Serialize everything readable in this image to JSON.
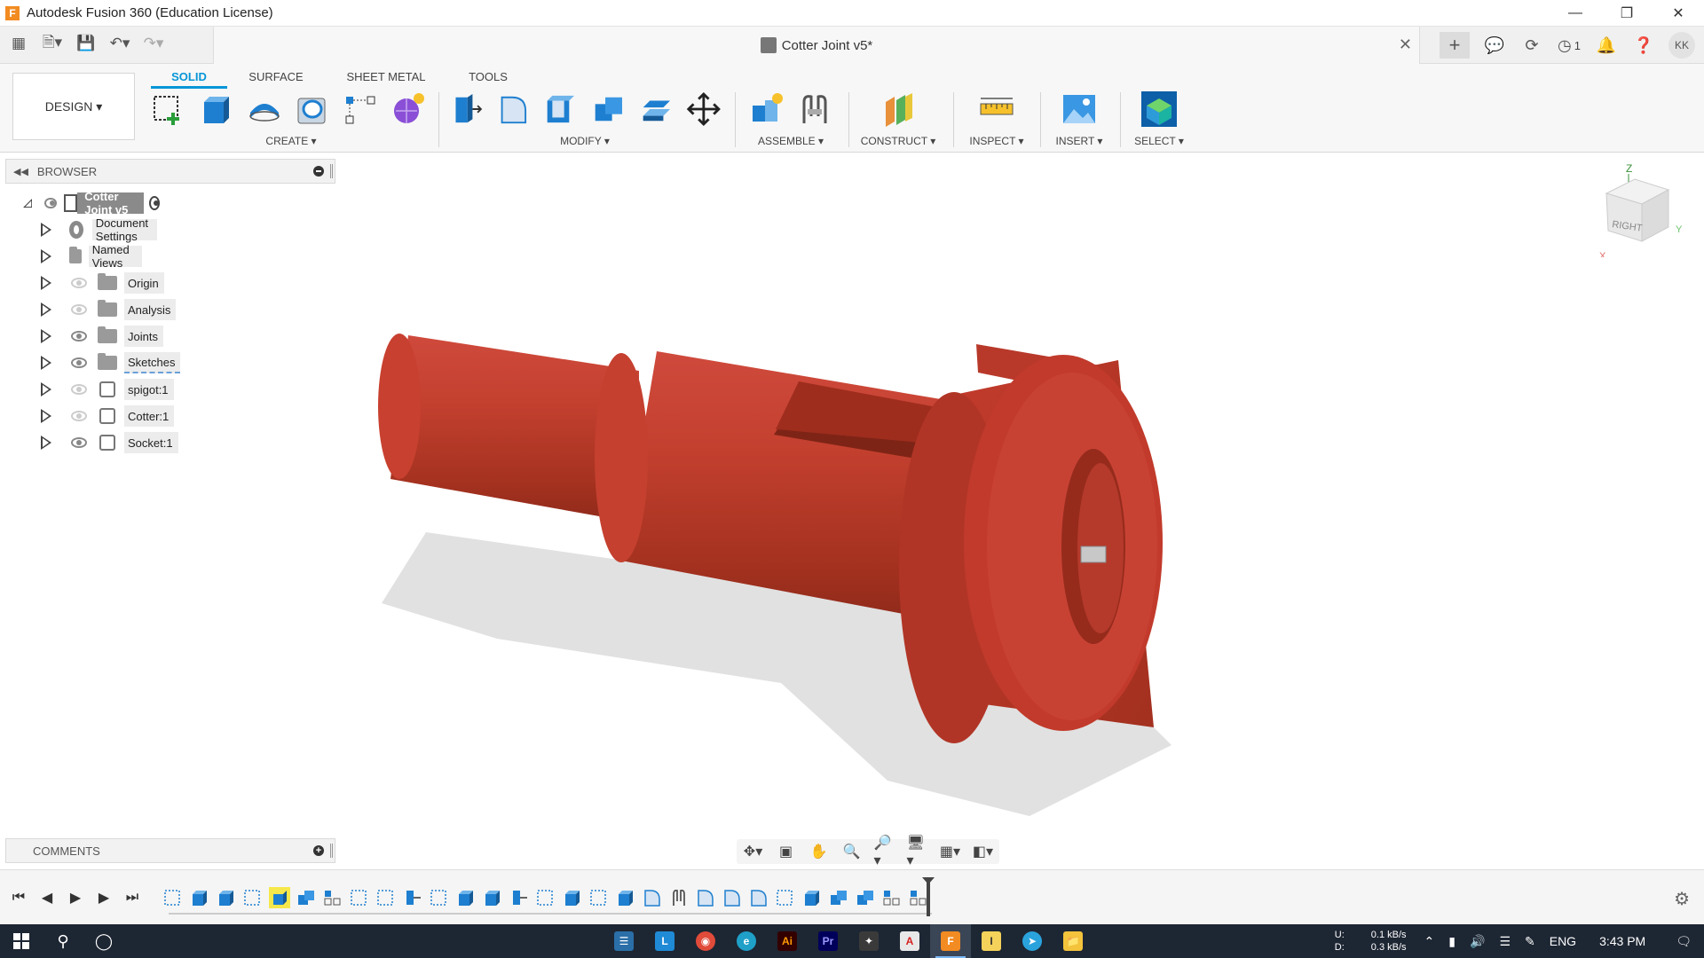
{
  "window": {
    "title": "Autodesk Fusion 360 (Education License)",
    "app_logo": "F",
    "controls": [
      "minimize-icon",
      "restore-icon",
      "close-icon"
    ]
  },
  "quick_access": {
    "document_title": "Cotter Joint v5*",
    "job_count": "1",
    "user_initials": "KK"
  },
  "ribbon": {
    "workspace_label": "DESIGN ▾",
    "tabs": [
      {
        "label": "SOLID",
        "active": true
      },
      {
        "label": "SURFACE",
        "active": false
      },
      {
        "label": "SHEET METAL",
        "active": false
      },
      {
        "label": "TOOLS",
        "active": false
      }
    ],
    "groups": {
      "create": "CREATE ▾",
      "modify": "MODIFY ▾",
      "assemble": "ASSEMBLE ▾",
      "construct": "CONSTRUCT ▾",
      "inspect": "INSPECT ▾",
      "insert": "INSERT ▾",
      "select": "SELECT ▾"
    }
  },
  "browser": {
    "title": "BROWSER",
    "root": "Cotter Joint v5",
    "items": [
      {
        "label": "Document Settings",
        "icon": "gear-icon",
        "visible": null
      },
      {
        "label": "Named Views",
        "icon": "folder-icon",
        "visible": null
      },
      {
        "label": "Origin",
        "icon": "folder-icon",
        "visible": false
      },
      {
        "label": "Analysis",
        "icon": "folder-icon",
        "visible": false
      },
      {
        "label": "Joints",
        "icon": "folder-icon",
        "visible": true
      },
      {
        "label": "Sketches",
        "icon": "folder-icon",
        "visible": true
      },
      {
        "label": "spigot:1",
        "icon": "body-icon",
        "visible": false
      },
      {
        "label": "Cotter:1",
        "icon": "body-icon",
        "visible": false
      },
      {
        "label": "Socket:1",
        "icon": "body-icon",
        "visible": true
      }
    ]
  },
  "viewcube": {
    "face": "RIGHT",
    "axis_z": "Z",
    "axis_y": "Y",
    "axis_x": "X"
  },
  "comments": {
    "title": "COMMENTS"
  },
  "colors": {
    "accent": "#0696d7",
    "model": "#b5372b",
    "taskbar": "#1d2633"
  },
  "taskbar": {
    "net_up_label": "U:",
    "net_down_label": "D:",
    "net_up": "0.1 kB/s",
    "net_down": "0.3 kB/s",
    "language": "ENG",
    "time": "3:43 PM"
  }
}
